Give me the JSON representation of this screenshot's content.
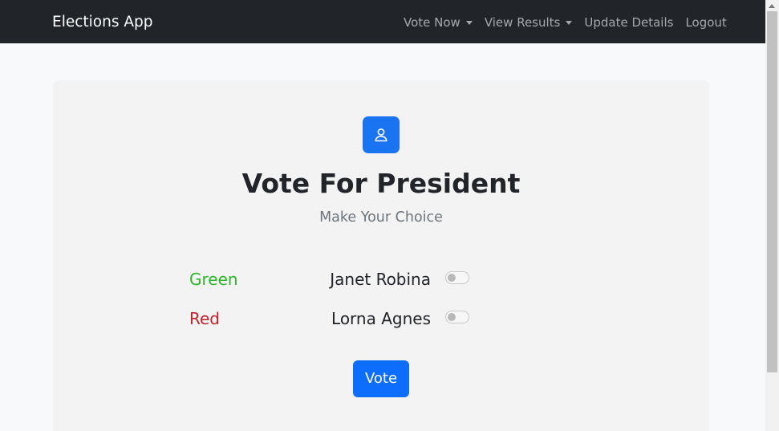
{
  "navbar": {
    "brand": "Elections App",
    "links": [
      {
        "label": "Vote Now",
        "dropdown": true
      },
      {
        "label": "View Results",
        "dropdown": true
      },
      {
        "label": "Update Details",
        "dropdown": false
      },
      {
        "label": "Logout",
        "dropdown": false
      }
    ]
  },
  "ballot": {
    "icon": "user-icon",
    "title": "Vote For President",
    "subtitle": "Make Your Choice",
    "candidates": [
      {
        "party": "Green",
        "party_color": "#2db52d",
        "name": "Janet Robina",
        "selected": false
      },
      {
        "party": "Red",
        "party_color": "#c0242a",
        "name": "Lorna Agnes",
        "selected": false
      }
    ],
    "submit_label": "Vote"
  },
  "colors": {
    "navbar_bg": "#212529",
    "primary": "#0d6efd"
  }
}
